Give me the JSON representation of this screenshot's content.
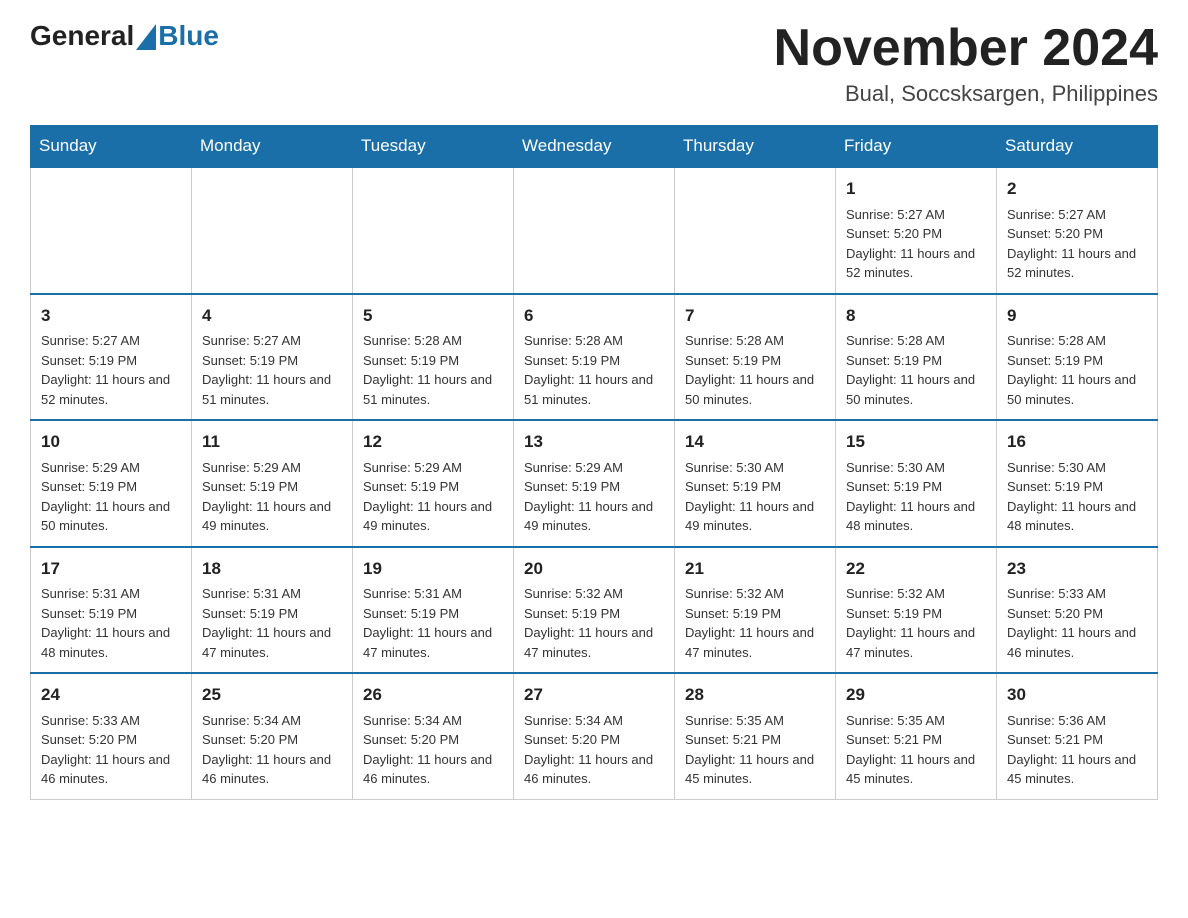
{
  "header": {
    "logo_general": "General",
    "logo_blue": "Blue",
    "month_title": "November 2024",
    "location": "Bual, Soccsksargen, Philippines"
  },
  "days_of_week": [
    "Sunday",
    "Monday",
    "Tuesday",
    "Wednesday",
    "Thursday",
    "Friday",
    "Saturday"
  ],
  "weeks": [
    {
      "days": [
        {
          "num": "",
          "info": ""
        },
        {
          "num": "",
          "info": ""
        },
        {
          "num": "",
          "info": ""
        },
        {
          "num": "",
          "info": ""
        },
        {
          "num": "",
          "info": ""
        },
        {
          "num": "1",
          "info": "Sunrise: 5:27 AM\nSunset: 5:20 PM\nDaylight: 11 hours and 52 minutes."
        },
        {
          "num": "2",
          "info": "Sunrise: 5:27 AM\nSunset: 5:20 PM\nDaylight: 11 hours and 52 minutes."
        }
      ]
    },
    {
      "days": [
        {
          "num": "3",
          "info": "Sunrise: 5:27 AM\nSunset: 5:19 PM\nDaylight: 11 hours and 52 minutes."
        },
        {
          "num": "4",
          "info": "Sunrise: 5:27 AM\nSunset: 5:19 PM\nDaylight: 11 hours and 51 minutes."
        },
        {
          "num": "5",
          "info": "Sunrise: 5:28 AM\nSunset: 5:19 PM\nDaylight: 11 hours and 51 minutes."
        },
        {
          "num": "6",
          "info": "Sunrise: 5:28 AM\nSunset: 5:19 PM\nDaylight: 11 hours and 51 minutes."
        },
        {
          "num": "7",
          "info": "Sunrise: 5:28 AM\nSunset: 5:19 PM\nDaylight: 11 hours and 50 minutes."
        },
        {
          "num": "8",
          "info": "Sunrise: 5:28 AM\nSunset: 5:19 PM\nDaylight: 11 hours and 50 minutes."
        },
        {
          "num": "9",
          "info": "Sunrise: 5:28 AM\nSunset: 5:19 PM\nDaylight: 11 hours and 50 minutes."
        }
      ]
    },
    {
      "days": [
        {
          "num": "10",
          "info": "Sunrise: 5:29 AM\nSunset: 5:19 PM\nDaylight: 11 hours and 50 minutes."
        },
        {
          "num": "11",
          "info": "Sunrise: 5:29 AM\nSunset: 5:19 PM\nDaylight: 11 hours and 49 minutes."
        },
        {
          "num": "12",
          "info": "Sunrise: 5:29 AM\nSunset: 5:19 PM\nDaylight: 11 hours and 49 minutes."
        },
        {
          "num": "13",
          "info": "Sunrise: 5:29 AM\nSunset: 5:19 PM\nDaylight: 11 hours and 49 minutes."
        },
        {
          "num": "14",
          "info": "Sunrise: 5:30 AM\nSunset: 5:19 PM\nDaylight: 11 hours and 49 minutes."
        },
        {
          "num": "15",
          "info": "Sunrise: 5:30 AM\nSunset: 5:19 PM\nDaylight: 11 hours and 48 minutes."
        },
        {
          "num": "16",
          "info": "Sunrise: 5:30 AM\nSunset: 5:19 PM\nDaylight: 11 hours and 48 minutes."
        }
      ]
    },
    {
      "days": [
        {
          "num": "17",
          "info": "Sunrise: 5:31 AM\nSunset: 5:19 PM\nDaylight: 11 hours and 48 minutes."
        },
        {
          "num": "18",
          "info": "Sunrise: 5:31 AM\nSunset: 5:19 PM\nDaylight: 11 hours and 47 minutes."
        },
        {
          "num": "19",
          "info": "Sunrise: 5:31 AM\nSunset: 5:19 PM\nDaylight: 11 hours and 47 minutes."
        },
        {
          "num": "20",
          "info": "Sunrise: 5:32 AM\nSunset: 5:19 PM\nDaylight: 11 hours and 47 minutes."
        },
        {
          "num": "21",
          "info": "Sunrise: 5:32 AM\nSunset: 5:19 PM\nDaylight: 11 hours and 47 minutes."
        },
        {
          "num": "22",
          "info": "Sunrise: 5:32 AM\nSunset: 5:19 PM\nDaylight: 11 hours and 47 minutes."
        },
        {
          "num": "23",
          "info": "Sunrise: 5:33 AM\nSunset: 5:20 PM\nDaylight: 11 hours and 46 minutes."
        }
      ]
    },
    {
      "days": [
        {
          "num": "24",
          "info": "Sunrise: 5:33 AM\nSunset: 5:20 PM\nDaylight: 11 hours and 46 minutes."
        },
        {
          "num": "25",
          "info": "Sunrise: 5:34 AM\nSunset: 5:20 PM\nDaylight: 11 hours and 46 minutes."
        },
        {
          "num": "26",
          "info": "Sunrise: 5:34 AM\nSunset: 5:20 PM\nDaylight: 11 hours and 46 minutes."
        },
        {
          "num": "27",
          "info": "Sunrise: 5:34 AM\nSunset: 5:20 PM\nDaylight: 11 hours and 46 minutes."
        },
        {
          "num": "28",
          "info": "Sunrise: 5:35 AM\nSunset: 5:21 PM\nDaylight: 11 hours and 45 minutes."
        },
        {
          "num": "29",
          "info": "Sunrise: 5:35 AM\nSunset: 5:21 PM\nDaylight: 11 hours and 45 minutes."
        },
        {
          "num": "30",
          "info": "Sunrise: 5:36 AM\nSunset: 5:21 PM\nDaylight: 11 hours and 45 minutes."
        }
      ]
    }
  ]
}
